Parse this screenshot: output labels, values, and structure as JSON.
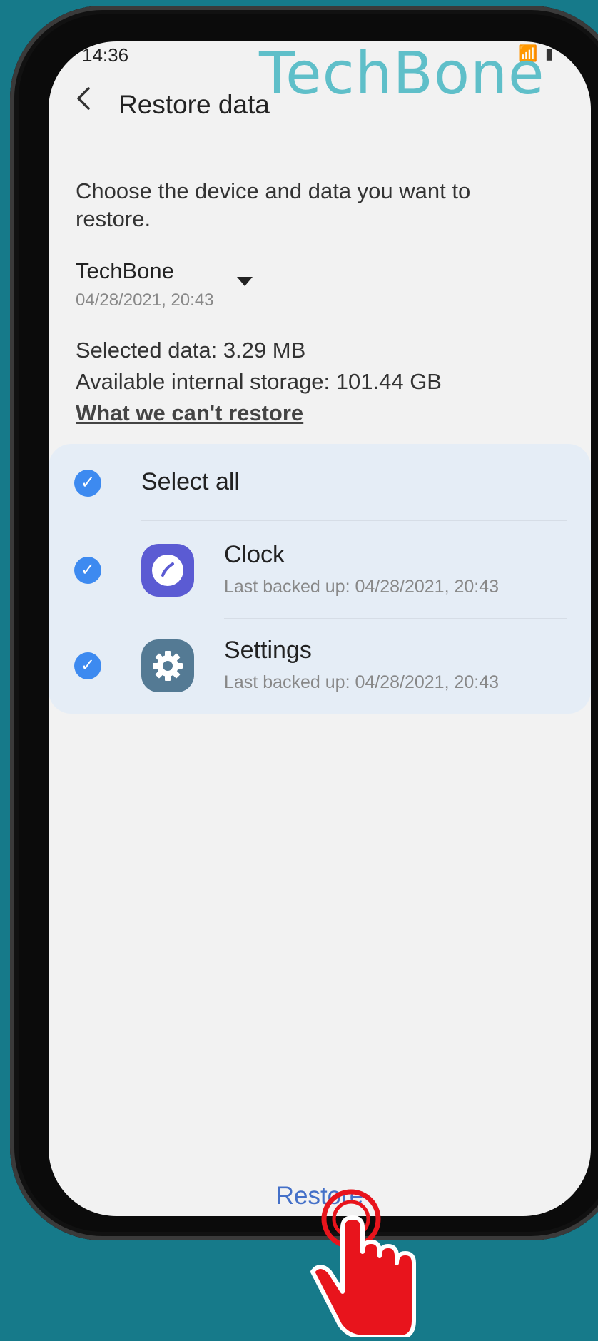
{
  "status_bar": {
    "time": "14:36",
    "icons": "📶 ▮"
  },
  "watermark": "TechBone",
  "header": {
    "title": "Restore data"
  },
  "description": "Choose the device and data you want to restore.",
  "device": {
    "name": "TechBone",
    "date": "04/28/2021, 20:43"
  },
  "selected_data": "Selected data: 3.29 MB",
  "available_storage": "Available internal storage: 101.44 GB",
  "cant_restore_link": "What we can't restore",
  "list": {
    "select_all": "Select all",
    "items": [
      {
        "label": "Clock",
        "sub": "Last backed up: 04/28/2021, 20:43",
        "icon": "clock-icon"
      },
      {
        "label": "Settings",
        "sub": "Last backed up: 04/28/2021, 20:43",
        "icon": "gear-icon"
      }
    ]
  },
  "restore_button": "Restore",
  "colors": {
    "accent": "#3d8af0",
    "restore": "#4470c8",
    "pointer": "#e8141c",
    "background": "#167a8a"
  }
}
